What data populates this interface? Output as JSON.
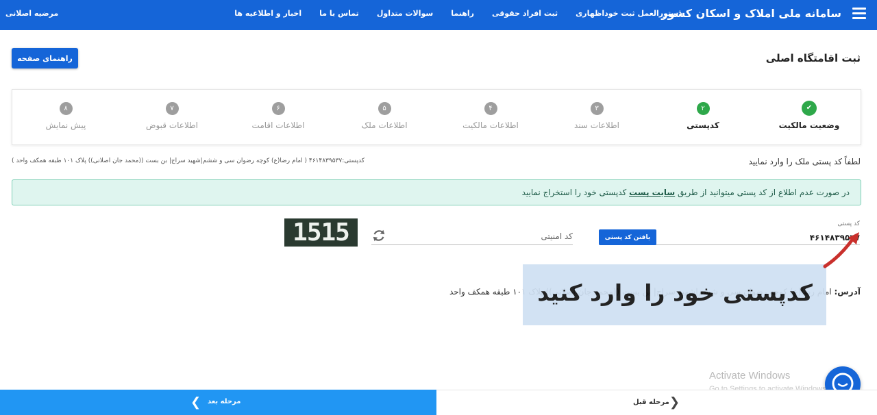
{
  "topbar": {
    "brand": "سامانه ملی املاک و اسکان کشور",
    "nav": [
      "اخبار و اطلاعیه ها",
      "تماس با ما",
      "سوالات متداول",
      "راهنما",
      "ثبت افراد حقوقی",
      "دستورالعمل ثبت خوداظهاری"
    ],
    "user": "مرضیه اصلانی"
  },
  "page": {
    "title": "ثبت اقامتگاه اصلی",
    "help_label": "راهنمای صفحه"
  },
  "steps": [
    {
      "num": "✔",
      "label": "وضعیت مالکیت",
      "state": "done"
    },
    {
      "num": "۲",
      "label": "کدپستی",
      "state": "active"
    },
    {
      "num": "۳",
      "label": "اطلاعات سند",
      "state": "pending"
    },
    {
      "num": "۴",
      "label": "اطلاعات مالکیت",
      "state": "pending"
    },
    {
      "num": "۵",
      "label": "اطلاعات ملک",
      "state": "pending"
    },
    {
      "num": "۶",
      "label": "اطلاعات اقامت",
      "state": "pending"
    },
    {
      "num": "۷",
      "label": "اطلاعات قبوض",
      "state": "pending"
    },
    {
      "num": "۸",
      "label": "پیش نمایش",
      "state": "pending"
    }
  ],
  "form": {
    "hint": "لطفاً کد پستی ملک را وارد نمایید",
    "postal_summary": "کدپستی:۴۶۱۴۸۳۹۵۳۷ ( امام رضا(ع) کوچه رضوان سی و ششم|شهید سراج| بن بست ((محمد جان اصلانی)) پلاک ۱۰۱ طبقه همکف واحد )",
    "alert_pre": "در صورت عدم اطلاع از کد پستی میتوانید از طریق",
    "alert_link": "سایت پست",
    "alert_post": "کدپستی خود را استخراج نمایید",
    "postal_label": "کد پستی",
    "postal_value": "۴۶۱۴۸۳۹۵۳۷",
    "find_label": "یافتن کد پستی",
    "security_label": "کد امنیتی",
    "captcha": "1515",
    "address_key": "آدرس:",
    "address_value": "امام رضا(ع) کوچه رضوان سی و ششم|شهید سراج| بن بست ((محمد جان اصلانی)) پلاک ۱۰۱ طبقه همکف واحد"
  },
  "overlay": {
    "text": "کدپستی خود را وارد کنید"
  },
  "watermark": {
    "line1": "Activate Windows",
    "line2": "Go to Settings to activate Windows."
  },
  "bottom": {
    "next_label": "مرحله بعد",
    "prev_label": "مرحله قبل"
  },
  "colors": {
    "primary": "#1565d8",
    "success": "#2ea84a",
    "alert_bg": "#dff5ef",
    "next_bg": "#2196f3"
  }
}
